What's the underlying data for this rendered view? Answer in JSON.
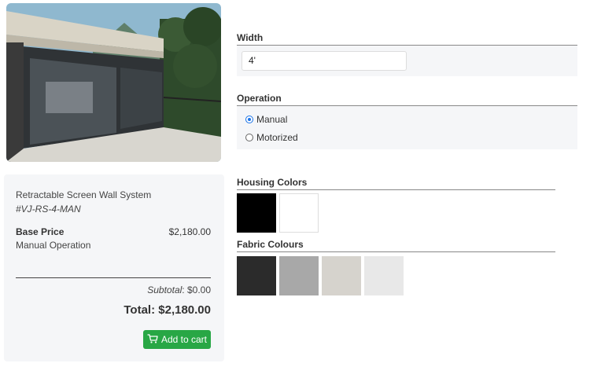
{
  "product": {
    "name": "Retractable Screen Wall System",
    "sku": "#VJ-RS-4-MAN",
    "base_price_label": "Base Price",
    "base_price_value": "$2,180.00",
    "operation_label": "Manual Operation",
    "subtotal_label": "Subtotal",
    "subtotal_value": ": $0.00",
    "total_text": "Total: $2,180.00",
    "add_to_cart_label": "Add to cart"
  },
  "width": {
    "title": "Width",
    "value": "4'"
  },
  "operation": {
    "title": "Operation",
    "options": [
      {
        "label": "Manual",
        "selected": true
      },
      {
        "label": "Motorized",
        "selected": false
      }
    ]
  },
  "housing_colors": {
    "title": "Housing Colors",
    "swatches": [
      "#000000",
      "#ffffff"
    ]
  },
  "fabric_colours": {
    "title": "Fabric Colours",
    "swatches": [
      "#2b2b2b",
      "#a8a8a8",
      "#d6d3cd",
      "#e8e8e8"
    ]
  },
  "colors": {
    "accent": "#28a745",
    "radio_selected": "#1a73e8",
    "panel_bg": "#f5f6f8"
  },
  "icons": {
    "cart": "cart-icon"
  }
}
